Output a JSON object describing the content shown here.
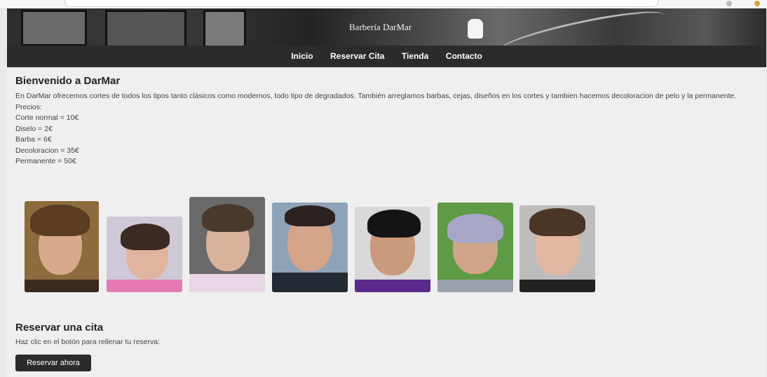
{
  "header": {
    "title": "Barbería DarMar"
  },
  "nav": {
    "items": [
      "Inicio",
      "Reservar Cita",
      "Tienda",
      "Contacto"
    ]
  },
  "main": {
    "heading": "Bienvenido a DarMar",
    "intro": "En DarMar ofrecemos cortes de todos los tipos tanto clásicos como modernos, todo tipo de degradados. También arreglamos barbas, cejas, diseños en los cortes y tambien hacemos decoloracion de pelo y la permanente.",
    "prices_label": "Precios:",
    "prices": [
      "Corte normal = 10€",
      "Diselo = 2€",
      "Barba = 6€",
      "Decoloracion = 35€",
      "Permanente = 50€"
    ]
  },
  "gallery": {
    "photos": [
      "haircut-photo",
      "haircut-photo",
      "haircut-photo",
      "haircut-photo",
      "haircut-photo",
      "haircut-photo",
      "haircut-photo"
    ]
  },
  "booking": {
    "title": "Reservar una cita",
    "text": "Haz clic en el botón para rellenar tu reserva:",
    "button": "Reservar ahora"
  },
  "colors": {
    "nav_bg": "#2b2b2b",
    "page_bg": "#efefef",
    "button_bg": "#2b2b2b"
  }
}
